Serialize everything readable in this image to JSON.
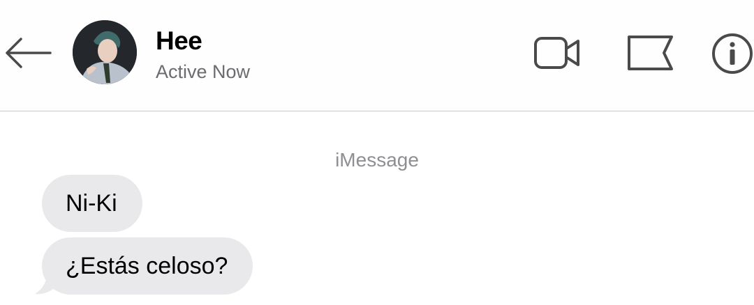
{
  "header": {
    "contact_name": "Hee",
    "contact_status": "Active Now",
    "icons": {
      "back": "back-arrow-icon",
      "video": "video-camera-icon",
      "flag": "flag-icon",
      "info": "info-icon"
    }
  },
  "conversation": {
    "service_label": "iMessage",
    "messages": [
      {
        "sender": "Hee",
        "direction": "incoming",
        "text": "Ni-Ki"
      },
      {
        "sender": "Hee",
        "direction": "incoming",
        "text": "¿Estás celoso?"
      }
    ]
  },
  "colors": {
    "incoming_bubble": "#e9e9eb",
    "icon_stroke": "#4a4a4a",
    "secondary_text": "#8e8e93"
  }
}
